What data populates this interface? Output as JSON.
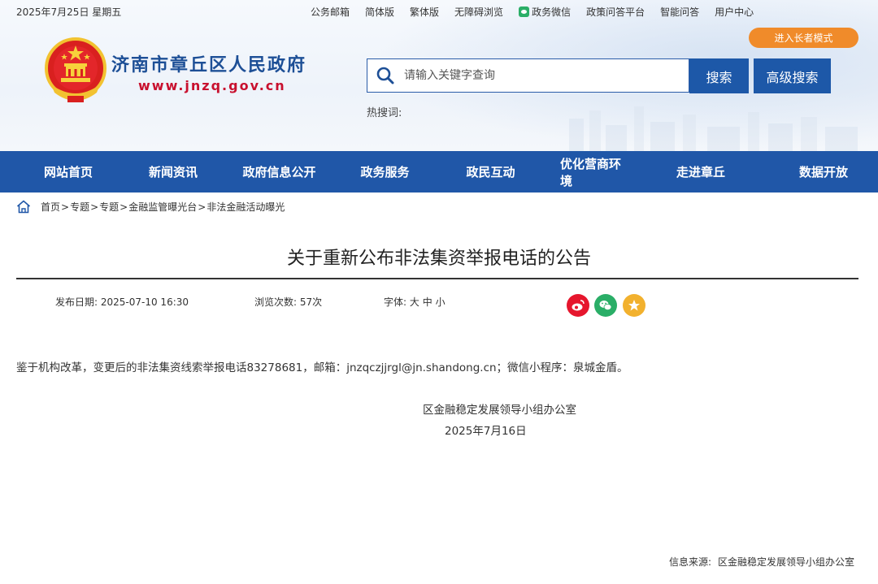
{
  "topbar": {
    "date": "2025年7月25日 星期五",
    "links": [
      "公务邮箱",
      "简体版",
      "繁体版",
      "无障碍浏览",
      "政务微信",
      "政策问答平台",
      "智能问答",
      "用户中心"
    ]
  },
  "elder_mode": "进入长者模式",
  "site": {
    "title": "济南市章丘区人民政府",
    "url": "www.jnzq.gov.cn"
  },
  "search": {
    "placeholder": "请输入关键字查询",
    "button": "搜索",
    "advanced": "高级搜索",
    "hot_label": "热搜词:"
  },
  "nav": [
    "网站首页",
    "新闻资讯",
    "政府信息公开",
    "政务服务",
    "政民互动",
    "优化营商环境",
    "走进章丘",
    "数据开放"
  ],
  "breadcrumb": [
    "首页",
    "专题",
    "专题",
    "金融监管曝光台",
    "非法金融活动曝光"
  ],
  "article": {
    "title": "关于重新公布非法集资举报电话的公告",
    "publish_label": "发布日期:",
    "publish_date": "2025-07-10 16:30",
    "views_label": "浏览次数:",
    "views": "57次",
    "font_label": "字体:",
    "font_sizes": [
      "大",
      "中",
      "小"
    ],
    "body": "鉴于机构改革，变更后的非法集资线索举报电话83278681，邮箱：jnzqczjjrgl@jn.shandong.cn；微信小程序：泉城金盾。",
    "signature_org": "区金融稳定发展领导小组办公室",
    "signature_date": "2025年7月16日",
    "source_label": "信息来源:",
    "source": "区金融稳定发展领导小组办公室"
  },
  "colors": {
    "nav_bg": "#2057a8",
    "title_blue": "#1d4f96",
    "url_red": "#c8102e",
    "elder_orange": "#f08b2a",
    "weibo_red": "#e6162d",
    "wechat_green": "#2aae67",
    "star_yellow": "#f2b12e"
  },
  "icons": [
    "national-emblem-icon",
    "search-icon",
    "home-icon",
    "weibo-icon",
    "wechat-icon",
    "favorite-star-icon"
  ]
}
